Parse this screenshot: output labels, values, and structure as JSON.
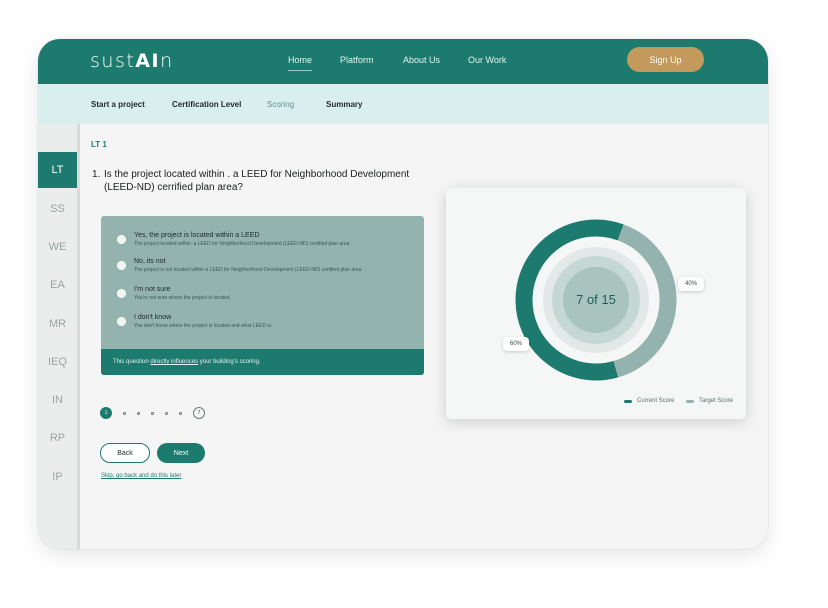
{
  "header": {
    "logo_main": "sust",
    "logo_ai": "AI",
    "logo_tail": "n",
    "nav": [
      "Home",
      "Platform",
      "About Us",
      "Our Work"
    ],
    "signup": "Sign Up"
  },
  "steps": [
    "Start a project",
    "Certification Level",
    "Scoring",
    "Summary"
  ],
  "sidebar": [
    "LT",
    "SS",
    "WE",
    "EA",
    "MR",
    "IEQ",
    "IN",
    "RP",
    "IP"
  ],
  "main": {
    "section": "LT 1",
    "question_number": "1.",
    "question": "Is the project located within . a LEED for Neighborhood Development (LEED-ND) cerrified plan area?",
    "options": [
      {
        "title": "Yes, the project is located within a LEED",
        "desc": "The project located within. a LEED for Neighborhood Development (LEED-ND) certified plan area"
      },
      {
        "title": "No, its not",
        "desc": "The project is not located within a LEED for Neighborhood Development (LEED-ND) certified plan area."
      },
      {
        "title": "I'm not sure",
        "desc": "You're not sure where the project is located."
      },
      {
        "title": "I don't know",
        "desc": "You don't know where the project is located and what LEED is."
      }
    ],
    "footer_prefix": "This question ",
    "footer_link": "directly influences",
    "footer_suffix": " your building's scoring.",
    "pager_current": "1",
    "pager_last": "7",
    "back": "Back",
    "next": "Next",
    "skip": "Skip, go back and do this later"
  },
  "colors": {
    "accent": "#1c7a6e",
    "accent_light": "#94b3ae",
    "gold": "#c49a5c"
  },
  "chart_data": {
    "type": "pie",
    "center_label": "7 of 15",
    "series": [
      {
        "name": "Current Score",
        "value": 60,
        "label": "60%",
        "color": "#1c7a6e"
      },
      {
        "name": "Target Score",
        "value": 40,
        "label": "40%",
        "color": "#94b3ae"
      }
    ],
    "legend": "bottom-right"
  }
}
